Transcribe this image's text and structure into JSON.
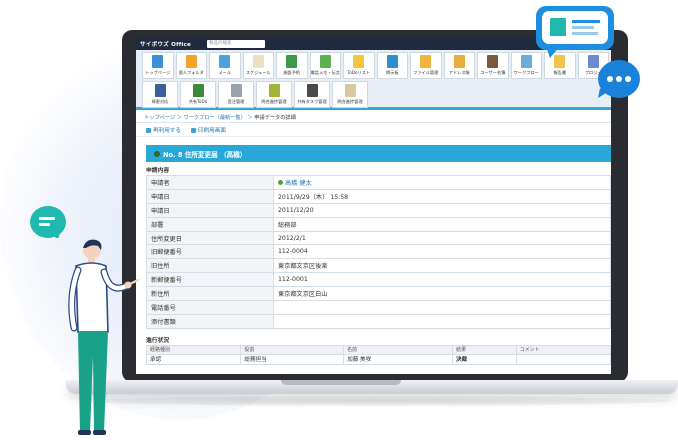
{
  "app": {
    "logo": "サイボウズ Office",
    "search_placeholder": "製品の検索"
  },
  "menu": {
    "row1": [
      {
        "label": "トップページ",
        "color": "#3b8fd6"
      },
      {
        "label": "個人フォルダ",
        "color": "#f1a32a"
      },
      {
        "label": "メール",
        "color": "#4aa3df"
      },
      {
        "label": "スケジュール",
        "color": "#e9e2c2"
      },
      {
        "label": "施設予約",
        "color": "#3b9a4a"
      },
      {
        "label": "電話メモ・伝言",
        "color": "#5fb04f"
      },
      {
        "label": "ToDoリスト",
        "color": "#f2c53b"
      },
      {
        "label": "掲示板",
        "color": "#2d8fd0"
      },
      {
        "label": "ファイル管理",
        "color": "#f1b43c"
      },
      {
        "label": "アドレス帳",
        "color": "#e8ad3a"
      },
      {
        "label": "ユーザー名簿",
        "color": "#7a5a3b"
      },
      {
        "label": "ワークフロー",
        "color": "#6aaed8"
      },
      {
        "label": "報告書",
        "color": "#f0c34a"
      },
      {
        "label": "プロジェ",
        "color": "#6a8ad6"
      }
    ],
    "row2": [
      {
        "label": "障害対応",
        "color": "#3f5f9b"
      },
      {
        "label": "共有ToDo",
        "color": "#3b8a3b"
      },
      {
        "label": "受注管理",
        "color": "#9aa3ad"
      },
      {
        "label": "問合進捗管理",
        "color": "#a3b33a"
      },
      {
        "label": "共有タスク管理",
        "color": "#4a4a4a"
      },
      {
        "label": "問合進捗管理",
        "color": "#d9c9a3"
      }
    ]
  },
  "breadcrumb": {
    "items": [
      "トップページ",
      "ワークフロー（最新一覧）"
    ],
    "current": "申請データの詳細"
  },
  "actions": {
    "reuse": "再利用する",
    "print": "印刷用画面"
  },
  "title": "No. 8 住所変更届 （高橋）",
  "section_request": "申請内容",
  "fields": [
    {
      "label": "申請者",
      "value": "高橋 健太",
      "user": true
    },
    {
      "label": "申請日",
      "value": "2011/9/29（木） 15:58"
    },
    {
      "label": "申請日",
      "value": "2011/12/20"
    },
    {
      "label": "部署",
      "value": "総務部"
    },
    {
      "label": "住所変更日",
      "value": "2012/2/1"
    },
    {
      "label": "旧郵便番号",
      "value": "112-0004"
    },
    {
      "label": "旧住所",
      "value": "東京都文京区後楽"
    },
    {
      "label": "新郵便番号",
      "value": "112-0001"
    },
    {
      "label": "新住所",
      "value": "東京都文京区白山"
    },
    {
      "label": "電話番号",
      "value": ""
    },
    {
      "label": "添付書類",
      "value": ""
    }
  ],
  "section_progress": "進行状況",
  "progress": {
    "headers": [
      "経路種別",
      "役割",
      "名前",
      "結果",
      "コメント"
    ],
    "row": [
      "承認",
      "総務担当",
      "加藤 美咲",
      "決裁",
      ""
    ]
  },
  "colors": {
    "accent": "#28a8d8",
    "header_bg": "#1f2b3c",
    "bubble_blue": "#1e8ee0",
    "bubble_teal": "#21b8b0"
  }
}
